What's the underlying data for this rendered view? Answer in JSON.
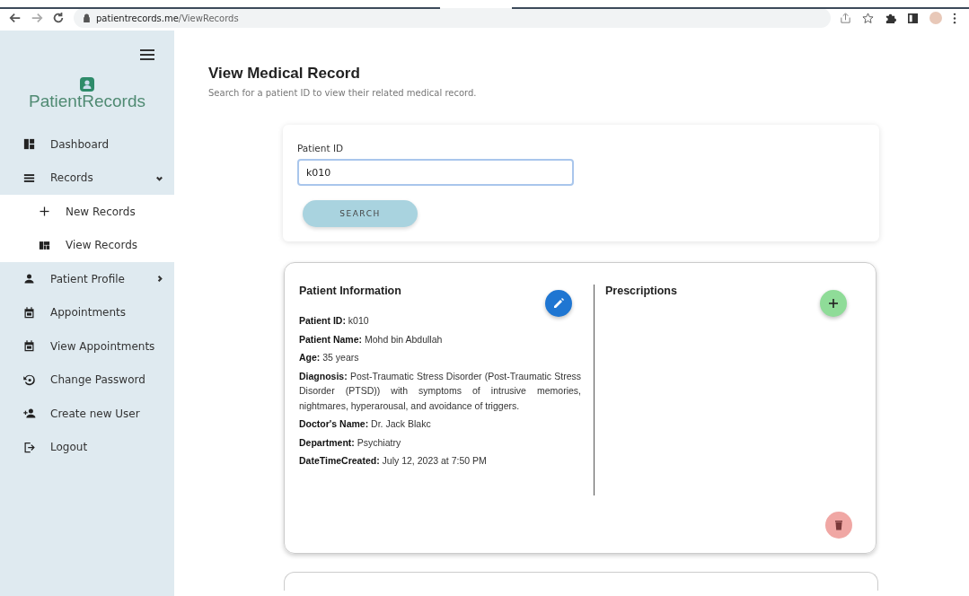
{
  "browser": {
    "url_host": "patientrecords.me",
    "url_path": "/ViewRecords"
  },
  "sidebar": {
    "logo": "PatientRecords",
    "items": [
      {
        "label": "Dashboard"
      },
      {
        "label": "Records",
        "expanded": true,
        "children": [
          {
            "label": "New Records"
          },
          {
            "label": "View Records"
          }
        ]
      },
      {
        "label": "Patient Profile",
        "expanded": false
      },
      {
        "label": "Appointments"
      },
      {
        "label": "View Appointments"
      },
      {
        "label": "Change Password"
      },
      {
        "label": "Create new User"
      },
      {
        "label": "Logout"
      }
    ]
  },
  "page": {
    "title": "View Medical Record",
    "subtitle": "Search for a patient ID to view their related medical record."
  },
  "search": {
    "label": "Patient ID",
    "value": "k010",
    "button": "SEARCH"
  },
  "record": {
    "title": "Patient Information",
    "fields": [
      {
        "label": "Patient ID:",
        "value": "k010"
      },
      {
        "label": "Patient Name:",
        "value": "Mohd bin Abdullah"
      },
      {
        "label": "Age:",
        "value": "35 years"
      },
      {
        "label": "Diagnosis:",
        "value": "Post-Traumatic Stress Disorder (Post-Traumatic Stress Disorder (PTSD)) with symptoms of intrusive memories, nightmares, hyperarousal, and avoidance of triggers."
      },
      {
        "label": "Doctor's Name:",
        "value": "Dr. Jack Blakc"
      },
      {
        "label": "Department:",
        "value": "Psychiatry"
      },
      {
        "label": "DateTimeCreated:",
        "value": "July 12, 2023 at 7:50 PM"
      }
    ],
    "prescriptions_title": "Prescriptions"
  }
}
